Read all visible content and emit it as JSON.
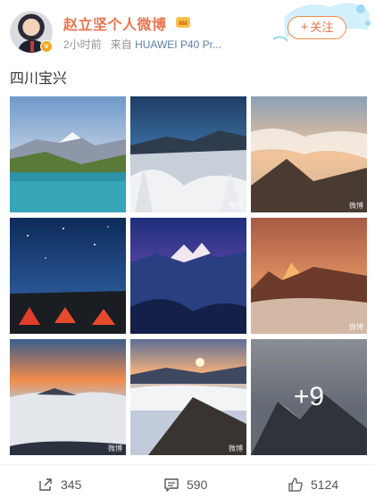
{
  "post": {
    "author_name": "赵立坚个人微博",
    "time": "2小时前",
    "source_prefix": "来自",
    "device": "HUAWEI P40 Pr...",
    "follow_label": "关注",
    "text": "四川宝兴",
    "images": [
      {
        "label": "lake-snow-mountain"
      },
      {
        "label": "snowy-peak-rime"
      },
      {
        "label": "sea-of-clouds-sunrise"
      },
      {
        "label": "starry-night-tents"
      },
      {
        "label": "blue-hour-peaks"
      },
      {
        "label": "golden-peak-clouds"
      },
      {
        "label": "sunset-cloud-sea"
      },
      {
        "label": "sunrise-ridge"
      },
      {
        "label": "snow-peak-overlay"
      }
    ],
    "more_count": "+9"
  },
  "actions": {
    "share_count": "345",
    "comment_count": "590",
    "like_count": "5124"
  },
  "colors": {
    "name": "#eb7350",
    "follow_border": "#f28a4a",
    "device_link": "#5d7fa9"
  }
}
